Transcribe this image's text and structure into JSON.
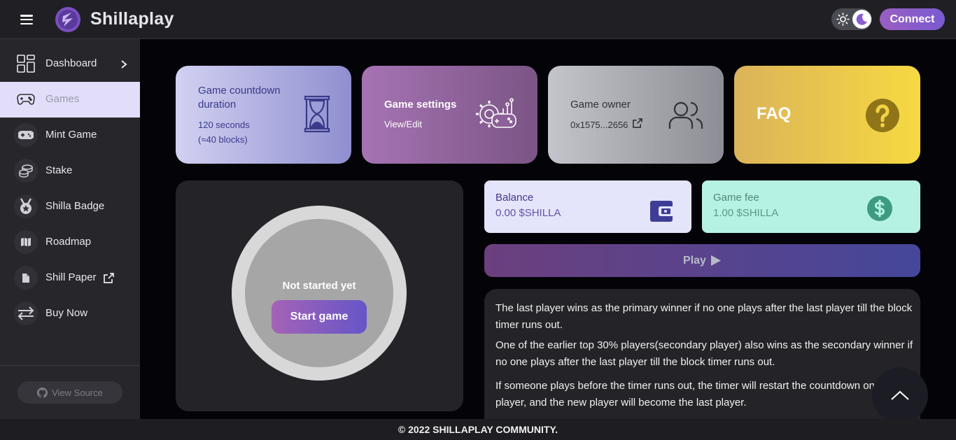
{
  "header": {
    "brand": "Shillaplay",
    "connect_label": "Connect"
  },
  "sidebar": {
    "items": [
      {
        "label": "Dashboard",
        "icon": "dashboard-icon"
      },
      {
        "label": "Games",
        "icon": "gamepad-icon",
        "active": true
      },
      {
        "label": "Mint Game",
        "icon": "controller-icon"
      },
      {
        "label": "Stake",
        "icon": "coins-icon"
      },
      {
        "label": "Shilla Badge",
        "icon": "medal-icon"
      },
      {
        "label": "Roadmap",
        "icon": "map-icon"
      },
      {
        "label": "Shill Paper",
        "icon": "document-icon"
      },
      {
        "label": "Buy Now",
        "icon": "swap-icon"
      }
    ],
    "view_source_label": "View Source"
  },
  "cards": {
    "countdown": {
      "title": "Game countdown duration",
      "value": "120 seconds",
      "blocks": "(≈40 blocks)"
    },
    "settings": {
      "title": "Game settings",
      "action": "View/Edit"
    },
    "owner": {
      "title": "Game owner",
      "address": "0x1575...2656"
    },
    "faq": {
      "title": "FAQ"
    }
  },
  "game": {
    "status": "Not started yet",
    "start_label": "Start game"
  },
  "balance": {
    "label": "Balance",
    "value": "0.00 $SHILLA"
  },
  "fee": {
    "label": "Game fee",
    "value": "1.00 $SHILLA"
  },
  "play_label": "Play",
  "rules": [
    "The last player wins as the primary winner if no one plays after the last player till the block timer runs out.",
    "One of the earlier top 30% players(secondary player) also wins as the secondary winner if no one plays after the last player till the block timer runs out.",
    "If someone plays before the timer runs out, the timer will restart the countdown on the new player, and the new player will become the last player."
  ],
  "footer": "© 2022 SHILLAPLAY COMMUNITY.",
  "colors": {
    "accent": "#9a5fc2",
    "faq": "#f6d942",
    "balance_bg": "#e4e4fb",
    "fee_bg": "#b6f2e4"
  }
}
